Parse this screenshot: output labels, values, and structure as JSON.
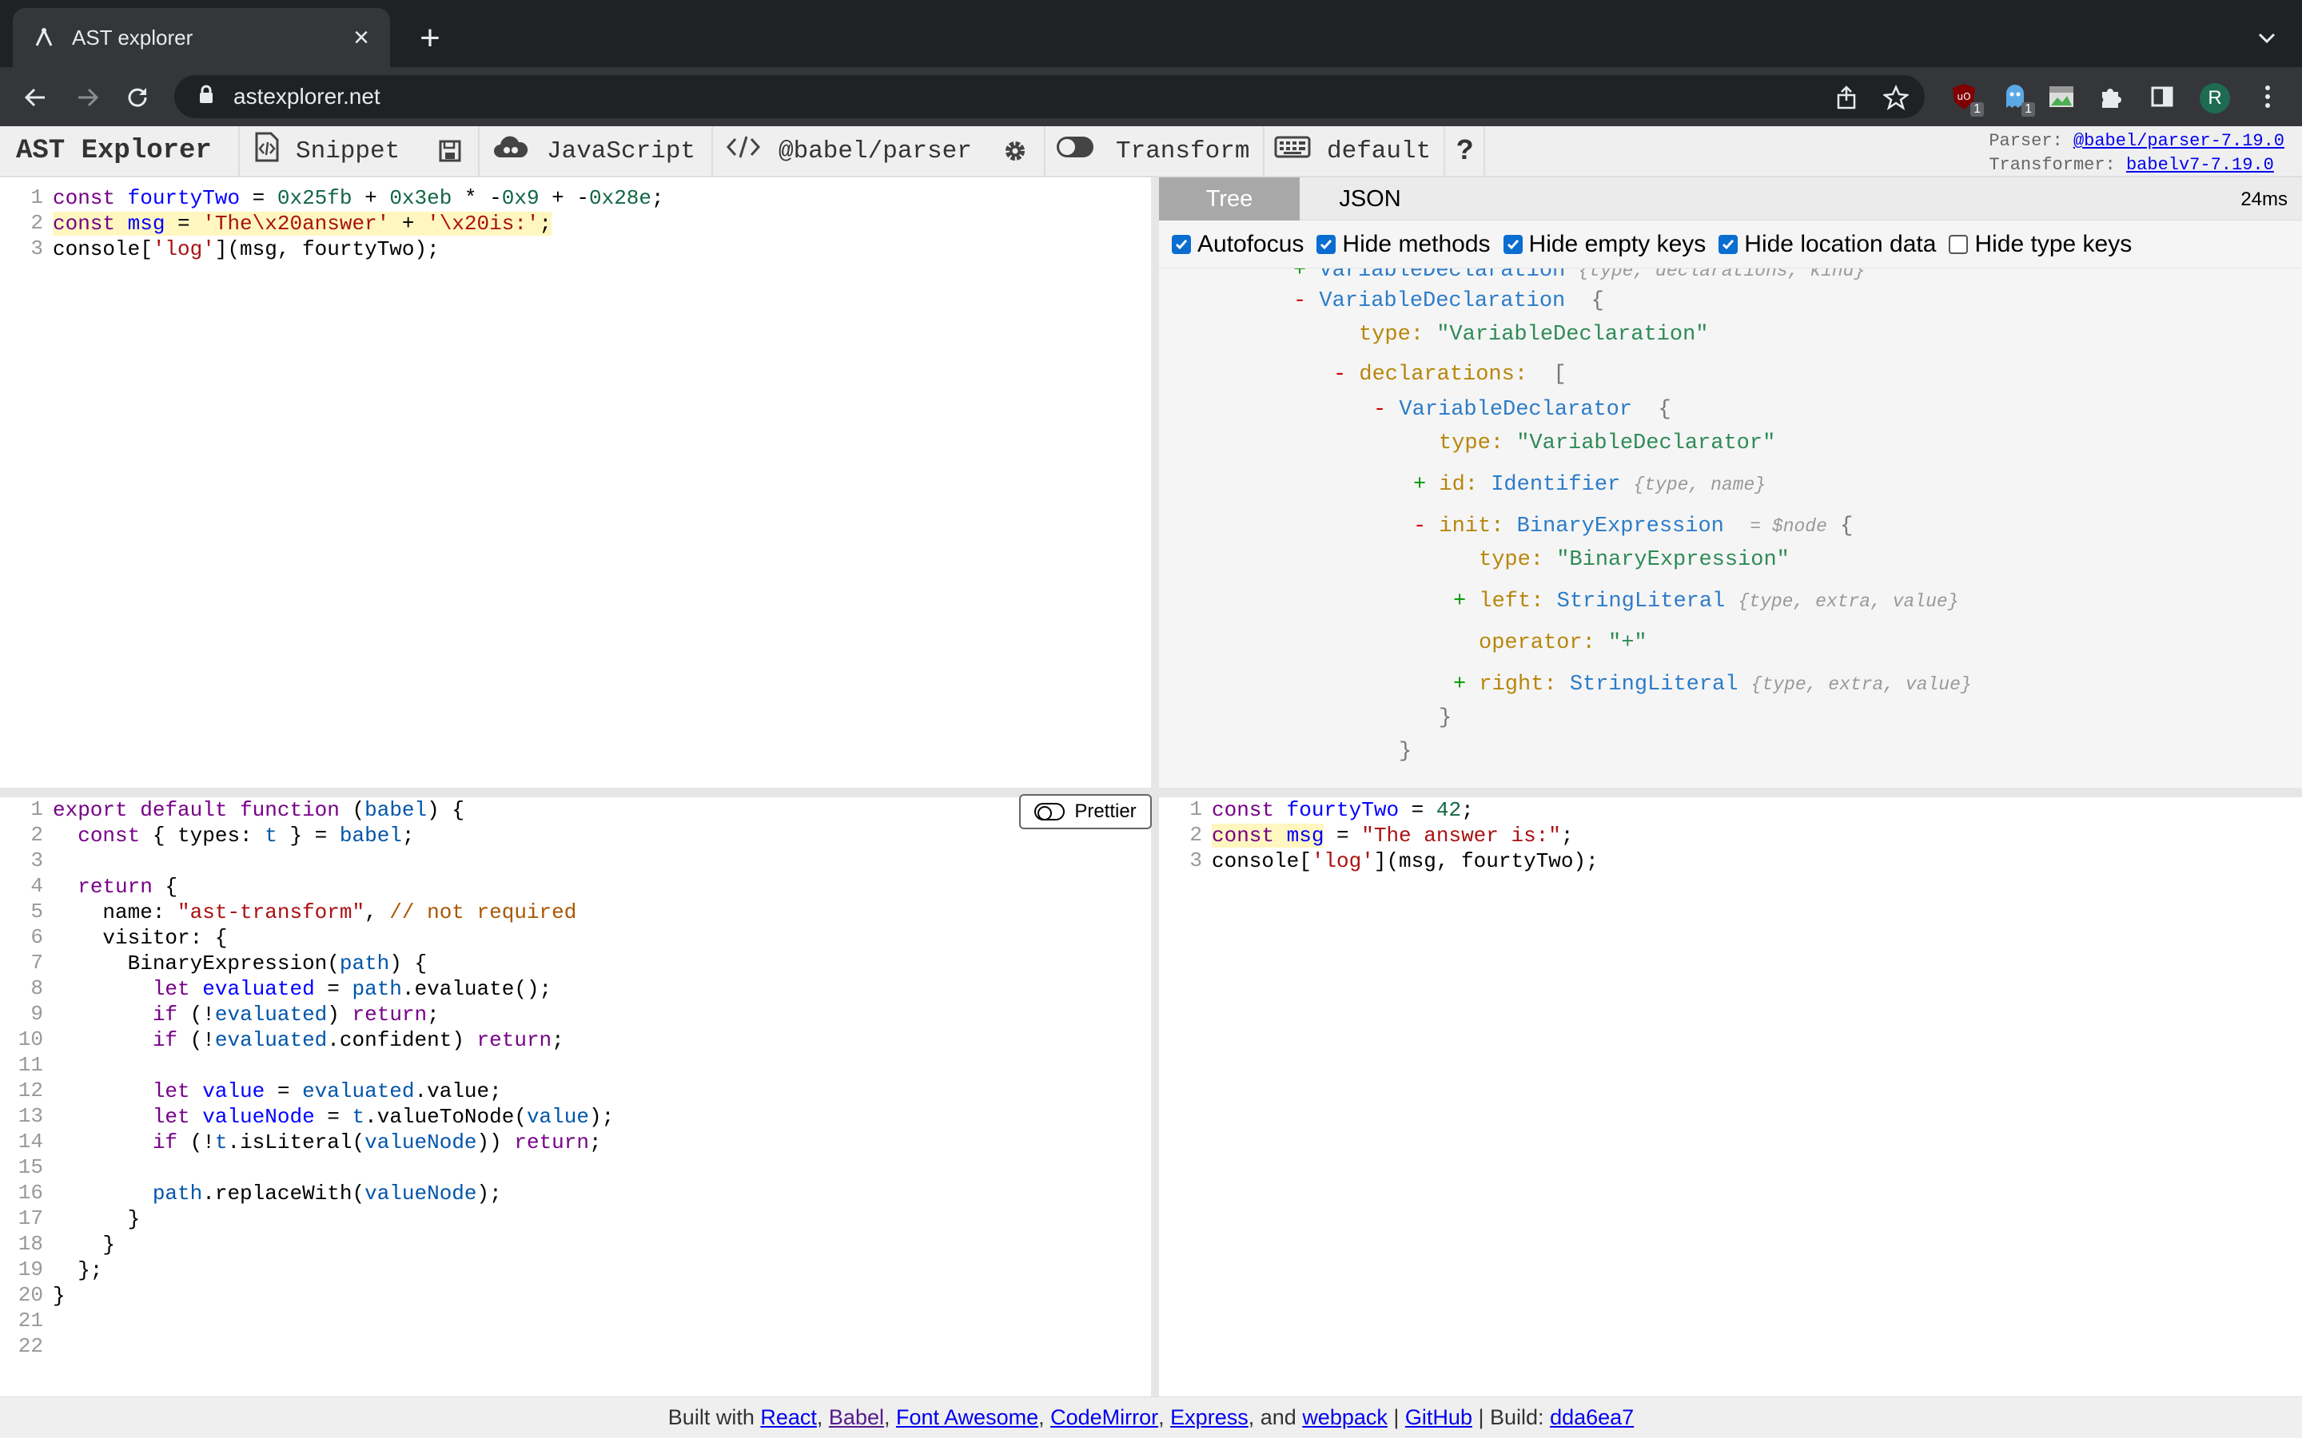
{
  "browser": {
    "tab_title": "AST explorer",
    "url": "astexplorer.net",
    "ext_badges": [
      "1",
      "1"
    ]
  },
  "toolbar": {
    "brand": "AST Explorer",
    "snippet": "Snippet",
    "language": "JavaScript",
    "parser": "@babel/parser",
    "transform": "Transform",
    "keymap": "default",
    "help": "?",
    "parser_label": "Parser:",
    "parser_link": "@babel/parser-7.19.0",
    "transformer_label": "Transformer:",
    "transformer_link": "babelv7-7.19.0"
  },
  "source": {
    "line_numbers": [
      "1",
      "2",
      "3"
    ]
  },
  "ast_panel": {
    "tabs": [
      "Tree",
      "JSON"
    ],
    "active_tab": "Tree",
    "timing": "24ms",
    "options": [
      {
        "label": "Autofocus",
        "checked": true
      },
      {
        "label": "Hide methods",
        "checked": true
      },
      {
        "label": "Hide empty keys",
        "checked": true
      },
      {
        "label": "Hide location data",
        "checked": true
      },
      {
        "label": "Hide type keys",
        "checked": false
      }
    ],
    "tree": {
      "top_node": "VariableDeclaration",
      "top_meta": "{type, declarations, kind}",
      "node1": "VariableDeclaration",
      "type_key": "type:",
      "type_val1": "\"VariableDeclaration\"",
      "declarations_key": "declarations:",
      "open_bracket": "[",
      "declarator": "VariableDeclarator",
      "type_val2": "\"VariableDeclarator\"",
      "id_key": "id:",
      "id_type": "Identifier",
      "id_meta": "{type, name}",
      "init_key": "init:",
      "init_type": "BinaryExpression",
      "node_ref": "= $node",
      "type_val3": "\"BinaryExpression\"",
      "left_key": "left:",
      "left_type": "StringLiteral",
      "lit_meta": "{type, extra, value}",
      "operator_key": "operator:",
      "operator_val": "\"+\"",
      "right_key": "right:",
      "right_type": "StringLiteral",
      "close_brace": "}"
    }
  },
  "transform_panel": {
    "prettier_label": "Prettier",
    "line_numbers": [
      "1",
      "2",
      "3",
      "4",
      "5",
      "6",
      "7",
      "8",
      "9",
      "10",
      "11",
      "12",
      "13",
      "14",
      "15",
      "16",
      "17",
      "18",
      "19",
      "20",
      "21",
      "22"
    ]
  },
  "output": {
    "line_numbers": [
      "1",
      "2",
      "3"
    ]
  },
  "footer": {
    "built_with": "Built with",
    "links": [
      "React",
      "Babel",
      "Font Awesome",
      "CodeMirror",
      "Express",
      "webpack"
    ],
    "and": "and",
    "github": "GitHub",
    "build_label": "Build:",
    "build_hash": "dda6ea7"
  }
}
